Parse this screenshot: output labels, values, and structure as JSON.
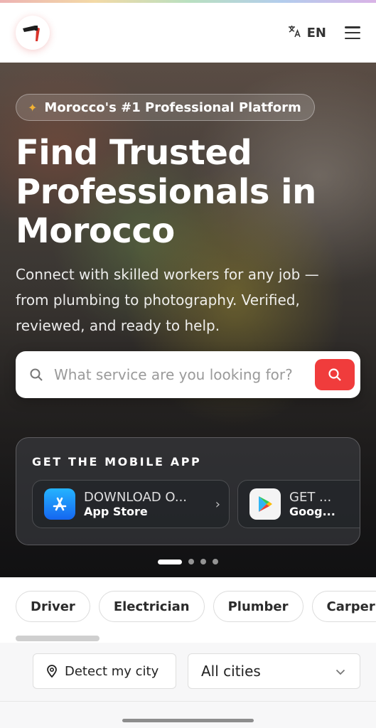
{
  "header": {
    "language": "EN",
    "icons": {
      "logo": "hammer-logo-icon",
      "language": "translate-icon",
      "menu": "hamburger-menu-icon"
    }
  },
  "hero": {
    "badge": "Morocco's #1 Professional Platform",
    "title": "Find Trusted Professionals in Morocco",
    "subtitle": "Connect with skilled workers for any job — from plumbing to photography. Verified, reviewed, and ready to help.",
    "search": {
      "placeholder": "What service are you looking for?"
    },
    "app_card": {
      "title": "GET THE MOBILE APP",
      "stores": [
        {
          "top": "DOWNLOAD O...",
          "name": "App Store"
        },
        {
          "top": "GET ...",
          "name": "Goog..."
        }
      ]
    },
    "carousel": {
      "slides": 4,
      "active": 1
    }
  },
  "categories": [
    "Driver",
    "Electrician",
    "Plumber",
    "Carper"
  ],
  "filters": {
    "detect_city": "Detect my city",
    "city_select": "All cities"
  },
  "colors": {
    "accent": "#f03c3c",
    "badge_star": "#f2b234"
  }
}
